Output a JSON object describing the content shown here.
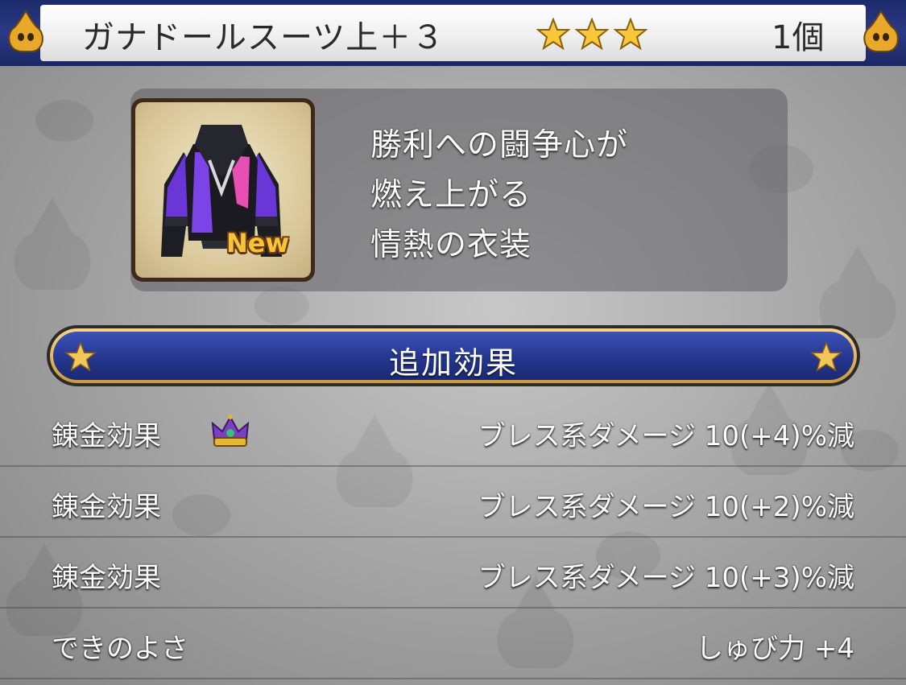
{
  "header": {
    "title": "ガナドールスーツ上＋３",
    "rarity_stars": 3,
    "count": "1個"
  },
  "item": {
    "icon": "jacket-icon",
    "badge": "New",
    "description": [
      "勝利への闘争心が",
      "燃え上がる",
      "情熱の衣装"
    ]
  },
  "section": {
    "title": "追加効果"
  },
  "effects": [
    {
      "label": "錬金効果",
      "value": "ブレス系ダメージ  10(+4)%減",
      "icon": "crown-icon"
    },
    {
      "label": "錬金効果",
      "value": "ブレス系ダメージ  10(+2)%減"
    },
    {
      "label": "錬金効果",
      "value": "ブレス系ダメージ  10(+3)%減"
    },
    {
      "label": "できのよさ",
      "value": "しゅび力  +4"
    }
  ],
  "colors": {
    "header_blue": "#1d2b6b",
    "banner_blue": "#24368e",
    "gold": "#f0c24a"
  }
}
